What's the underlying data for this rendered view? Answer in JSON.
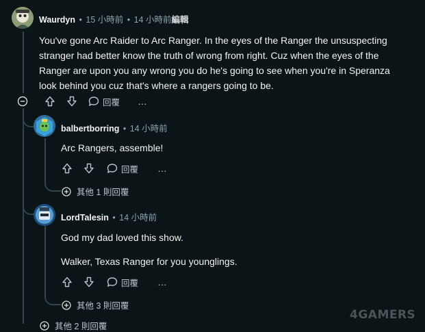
{
  "comments": [
    {
      "username": "Waurdyn",
      "dot": "•",
      "time": "15 小時前",
      "edited": "14 小時前",
      "edited_label": "編輯",
      "paragraphs": [
        "You've gone Arc Raider to Arc Ranger. In the eyes of the Ranger the unsuspecting",
        "stranger had better know the truth of wrong from right. Cuz when the eyes of the",
        "Ranger are upon you any wrong you do he's going to see when you're in Speranza",
        "look behind you cuz that's where a rangers going to be."
      ],
      "reply_label": "回覆",
      "more_label": "…"
    },
    {
      "username": "balbertborring",
      "dot": "•",
      "time": "14 小時前",
      "paragraphs": [
        "Arc Rangers, assemble!"
      ],
      "reply_label": "回覆",
      "more_label": "…",
      "more_replies": "其他 1 則回覆"
    },
    {
      "username": "LordTalesin",
      "dot": "•",
      "time": "14 小時前",
      "paragraphs": [
        "God my dad loved this show.",
        "Walker, Texas Ranger for you younglings."
      ],
      "reply_label": "回覆",
      "more_label": "…",
      "more_replies": "其他 3 則回覆"
    }
  ],
  "partial_bottom": "其他 2 則回覆",
  "watermark": "4GAMERS",
  "colors": {
    "background": "#0b1416",
    "text": "#f2f4f5",
    "meta": "#8ba2ad",
    "thread": "#33464c"
  },
  "icons": [
    "collapse-icon",
    "upvote-icon",
    "downvote-icon",
    "reply-icon",
    "more-icon",
    "plus-circle-icon"
  ]
}
